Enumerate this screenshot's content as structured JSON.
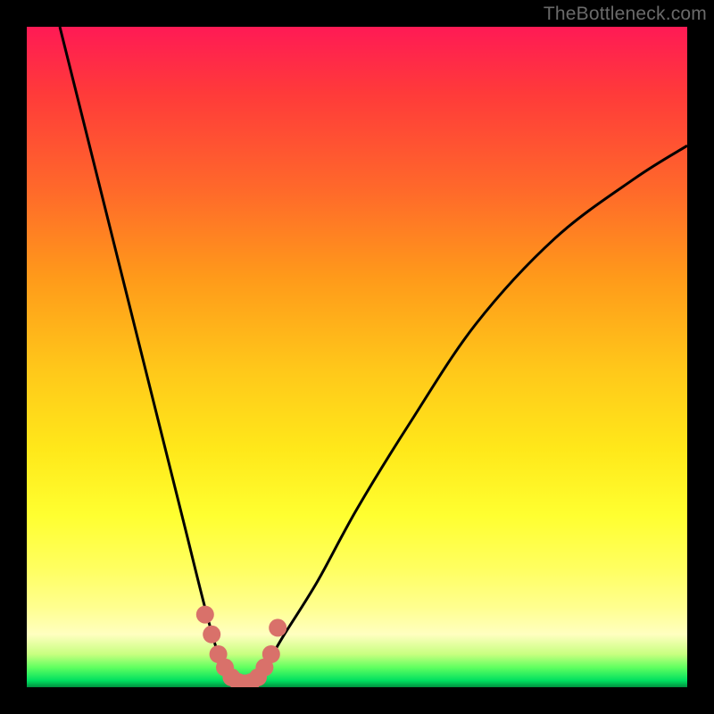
{
  "watermark": "TheBottleneck.com",
  "chart_data": {
    "type": "line",
    "title": "",
    "xlabel": "",
    "ylabel": "",
    "xlim": [
      0,
      100
    ],
    "ylim": [
      0,
      100
    ],
    "gradient_bands": [
      {
        "name": "red",
        "approx_y_range": [
          60,
          100
        ]
      },
      {
        "name": "orange",
        "approx_y_range": [
          35,
          60
        ]
      },
      {
        "name": "yellow",
        "approx_y_range": [
          8,
          35
        ]
      },
      {
        "name": "green",
        "approx_y_range": [
          0,
          8
        ]
      }
    ],
    "series": [
      {
        "name": "bottleneck-curve",
        "description": "V-shaped curve; steep descent on the left, minimum near x≈32, rising concave on the right",
        "x": [
          5,
          10,
          15,
          20,
          24,
          27,
          29,
          31,
          32,
          34,
          36,
          39,
          44,
          50,
          58,
          68,
          80,
          92,
          100
        ],
        "y": [
          100,
          80,
          60,
          40,
          24,
          12,
          5,
          1,
          0,
          1,
          3,
          8,
          16,
          27,
          40,
          55,
          68,
          77,
          82
        ]
      },
      {
        "name": "highlighted-dots",
        "description": "salmon-colored dots clustered around the trough of the curve",
        "x": [
          27,
          28,
          29,
          30,
          31,
          32,
          33,
          34,
          35,
          36,
          37,
          38
        ],
        "y": [
          11,
          8,
          5,
          3,
          1.5,
          0.8,
          0.6,
          0.8,
          1.5,
          3,
          5,
          9
        ]
      }
    ],
    "colors": {
      "curve": "#000000",
      "dots": "#d9716a",
      "background_top": "#ff1a55",
      "background_bottom": "#009040",
      "frame": "#000000"
    }
  }
}
